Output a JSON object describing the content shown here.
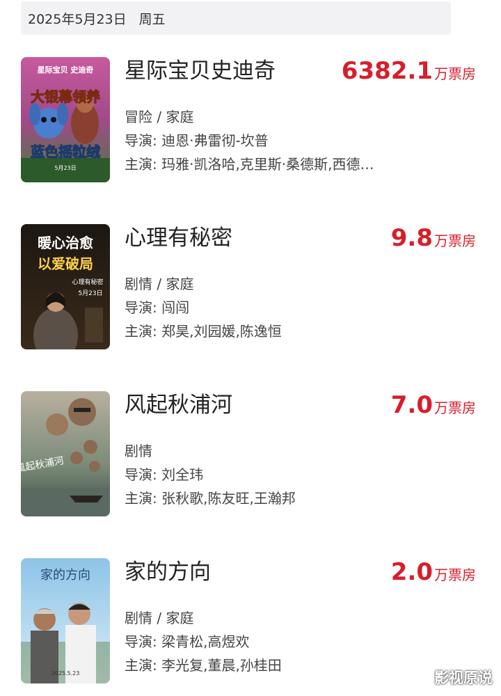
{
  "date_bar": {
    "date": "2025年5月23日",
    "weekday": "周五"
  },
  "movies": [
    {
      "title": "星际宝贝史迪奇",
      "box_number": "6382.1",
      "box_unit": "万票房",
      "genre": "冒险 / 家庭",
      "director": "导演: 迪恩·弗雷彻-坎普",
      "cast": "主演: 玛雅·凯洛哈,克里斯·桑德斯,西德…",
      "poster": {
        "top_text": "星际宝贝 史迪奇",
        "main_text": "大银幕领养",
        "sub_text": "蓝色摇粒绒",
        "date_text": "5月23日"
      }
    },
    {
      "title": "心理有秘密",
      "box_number": "9.8",
      "box_unit": "万票房",
      "genre": "剧情 / 家庭",
      "director": "导演: 闯闯",
      "cast": "主演: 郑昊,刘园媛,陈逸恒",
      "poster": {
        "line1": "暖心治愈",
        "line2": "以爱破局",
        "title_text": "心理有秘密",
        "date_text": "5月23日"
      }
    },
    {
      "title": "风起秋浦河",
      "box_number": "7.0",
      "box_unit": "万票房",
      "genre": "剧情",
      "director": "导演: 刘全玮",
      "cast": "主演: 张秋歌,陈友旺,王瀚邦",
      "poster": {
        "title_text": "風起秋浦河"
      }
    },
    {
      "title": "家的方向",
      "box_number": "2.0",
      "box_unit": "万票房",
      "genre": "剧情 / 家庭",
      "director": "导演: 梁青松,高煜欢",
      "cast": "主演: 李光复,董晨,孙桂田",
      "poster": {
        "title_text": "家的方向",
        "date_text": "2025.5.23"
      }
    }
  ],
  "watermark": "影视原说",
  "colors": {
    "accent": "#d81e2a",
    "date_bg": "#f2f2f4"
  }
}
